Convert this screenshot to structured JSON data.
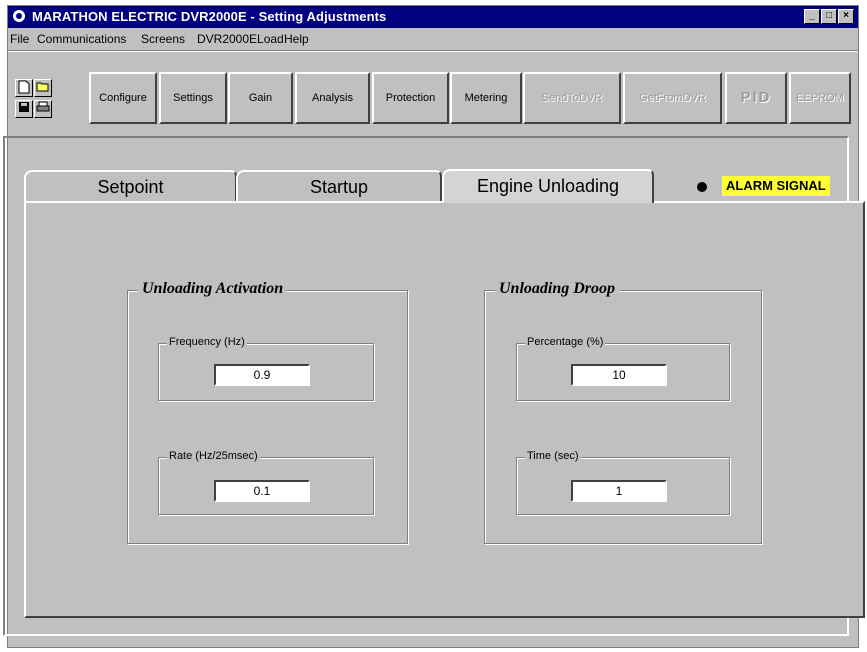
{
  "window": {
    "title": "MARATHON ELECTRIC DVR2000E - Setting Adjustments",
    "controls": {
      "minimize": "_",
      "maximize": "□",
      "close": "×"
    }
  },
  "menu": {
    "file": "File",
    "communications": "Communications",
    "screens": "Screens",
    "dvr_eload": "DVR2000ELoad",
    "help": "Help"
  },
  "toolbar": {
    "new_icon": "new-document-icon",
    "open_icon": "open-folder-icon",
    "save_icon": "save-disk-icon",
    "print_icon": "printer-icon",
    "configure": "Configure",
    "settings": "Settings",
    "gain": "Gain",
    "analysis": "Analysis",
    "protection": "Protection",
    "metering": "Metering",
    "send_to_dvr": "SendToDVR",
    "get_from_dvr": "GetFromDVR",
    "pid": "PID",
    "eeprom": "EEPROM"
  },
  "tabs": {
    "setpoint": "Setpoint",
    "startup": "Startup",
    "engine_unloading": "Engine Unloading"
  },
  "alarm": {
    "label": "ALARM SIGNAL",
    "color": "#ffff33"
  },
  "unloading_activation": {
    "title": "Unloading Activation",
    "frequency_label": "Frequency (Hz)",
    "frequency_value": "0.9",
    "rate_label": "Rate (Hz/25msec)",
    "rate_value": "0.1"
  },
  "unloading_droop": {
    "title": "Unloading Droop",
    "percentage_label": "Percentage (%)",
    "percentage_value": "10",
    "time_label": "Time (sec)",
    "time_value": "1"
  }
}
